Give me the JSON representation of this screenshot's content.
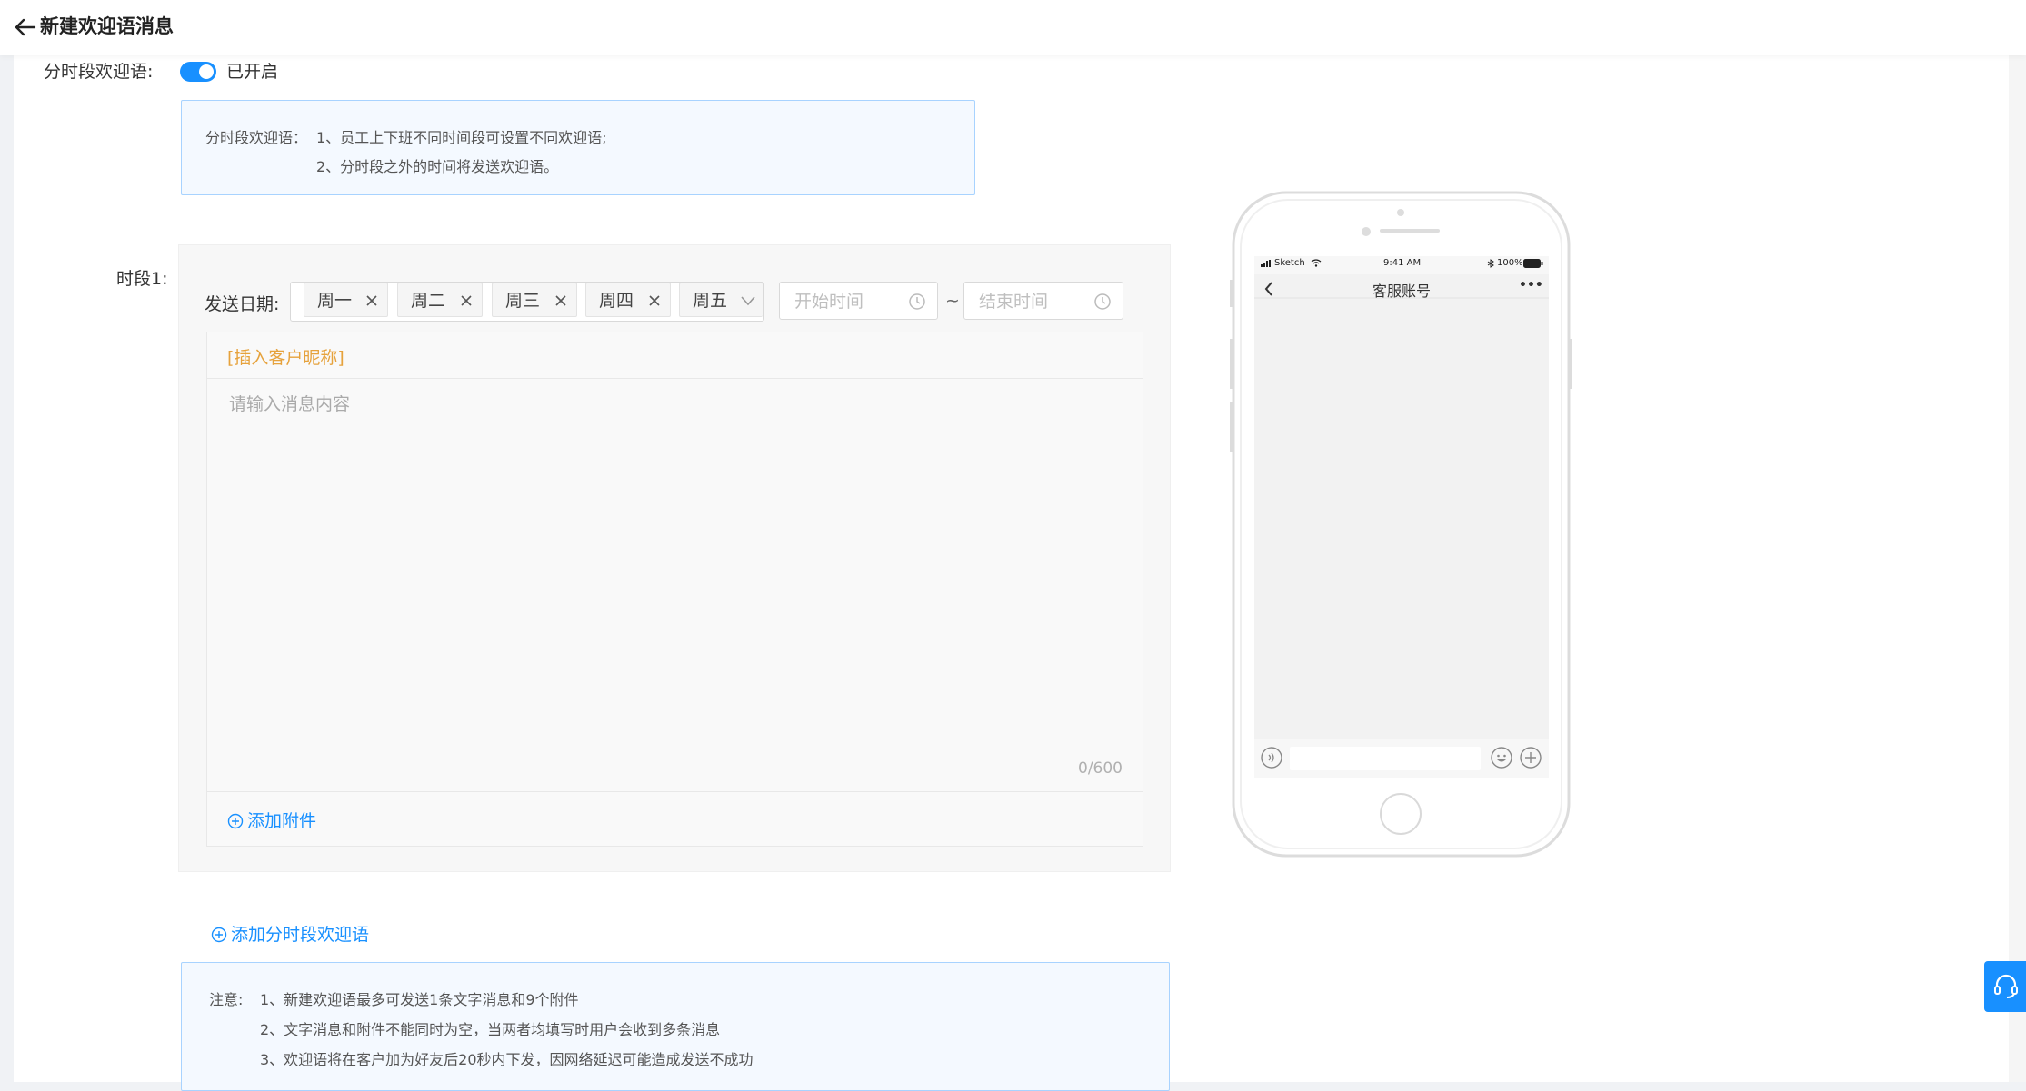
{
  "header": {
    "title": "新建欢迎语消息",
    "back_icon": "arrow-left-icon"
  },
  "timeslot_toggle": {
    "label": "分时段欢迎语:",
    "state": "已开启",
    "on": true
  },
  "info": {
    "prefix": "分时段欢迎语：",
    "lines": [
      "1、员工上下班不同时间段可设置不同欢迎语;",
      "2、分时段之外的时间将发送欢迎语。"
    ]
  },
  "segment": {
    "label": "时段1:",
    "date_label": "发送日期:",
    "days": [
      "周一",
      "周二",
      "周三",
      "周四",
      "周五"
    ],
    "start_placeholder": "开始时间",
    "tilde": "~",
    "end_placeholder": "结束时间",
    "insert_nickname": "[插入客户昵称]",
    "message_placeholder": "请输入消息内容",
    "counter": "0/600",
    "add_attachment": "添加附件"
  },
  "add_segment": "添加分时段欢迎语",
  "notes": {
    "prefix": "注意:",
    "lines": [
      "1、新建欢迎语最多可发送1条文字消息和9个附件",
      "2、文字消息和附件不能同时为空，当两者均填写时用户会收到多条消息",
      "3、欢迎语将在客户加为好友后20秒内下发，因网络延迟可能造成发送不成功"
    ]
  },
  "phone": {
    "carrier": "Sketch",
    "time": "9:41 AM",
    "battery": "100%",
    "chat_title": "客服账号",
    "more": "•••"
  },
  "colors": {
    "primary": "#1890ff",
    "warning": "#e6a23c"
  }
}
